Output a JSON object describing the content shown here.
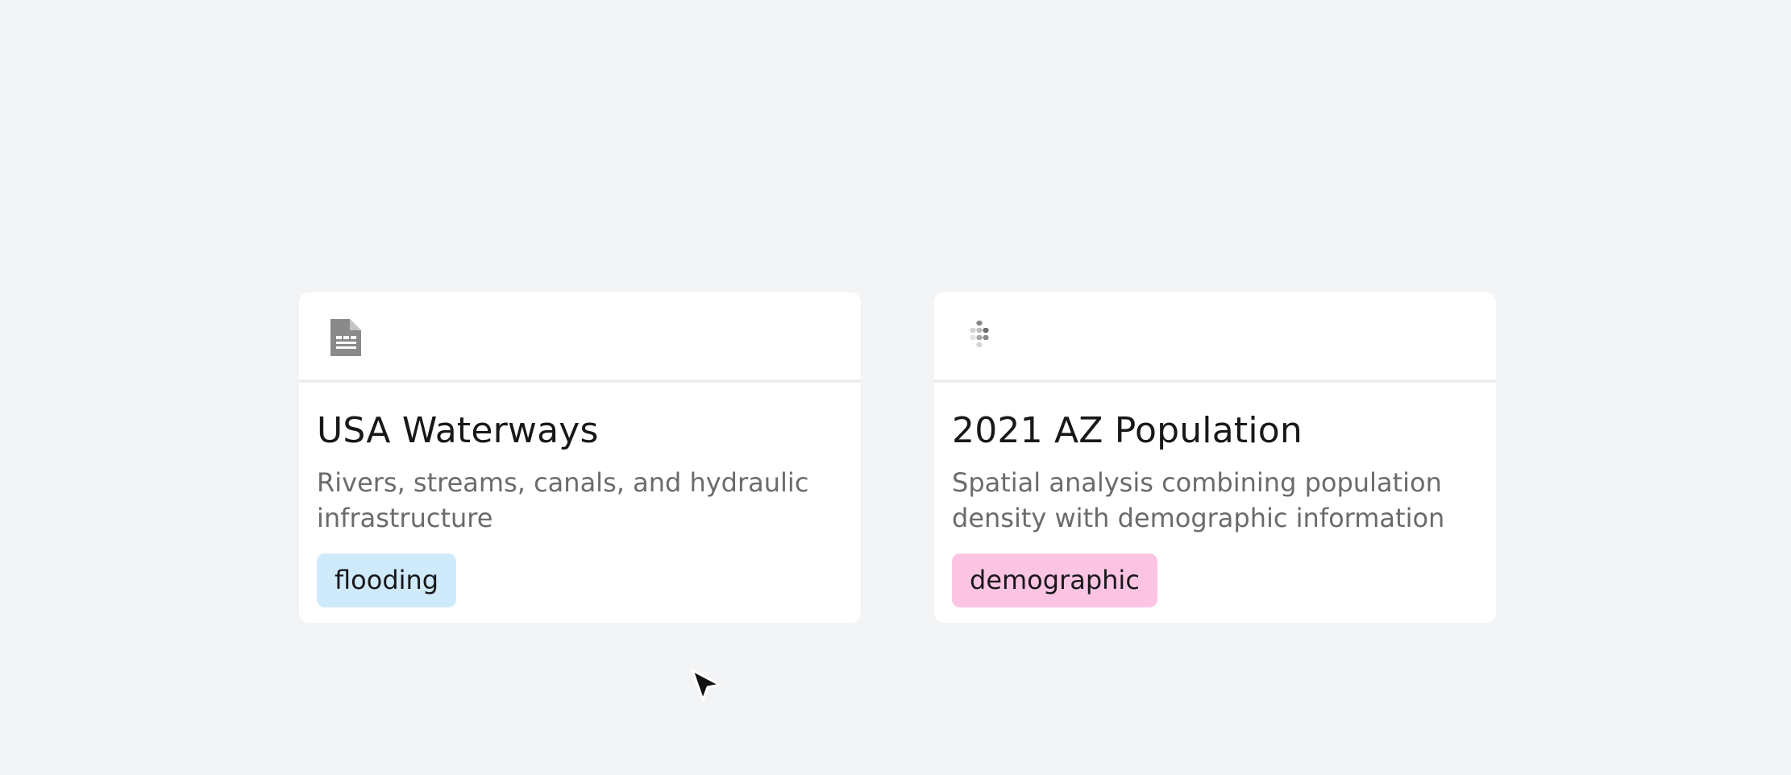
{
  "cards": [
    {
      "icon": "document-table-icon",
      "title": "USA Waterways",
      "description": "Rivers, streams, canals, and hydraulic infrastructure",
      "tag": "flooding",
      "tag_color": "#cfeafb"
    },
    {
      "icon": "hexagon-cluster-icon",
      "title": "2021 AZ Population",
      "description": "Spatial analysis combining population density with demographic information",
      "tag": "demographic",
      "tag_color": "#fcc4e3"
    }
  ],
  "colors": {
    "background": "#f3f4f6",
    "card": "#ffffff",
    "title": "#18181b",
    "description": "#6b6b6b",
    "icon": "#8a8a8a"
  },
  "cursor": {
    "icon": "mouse-pointer-icon"
  }
}
